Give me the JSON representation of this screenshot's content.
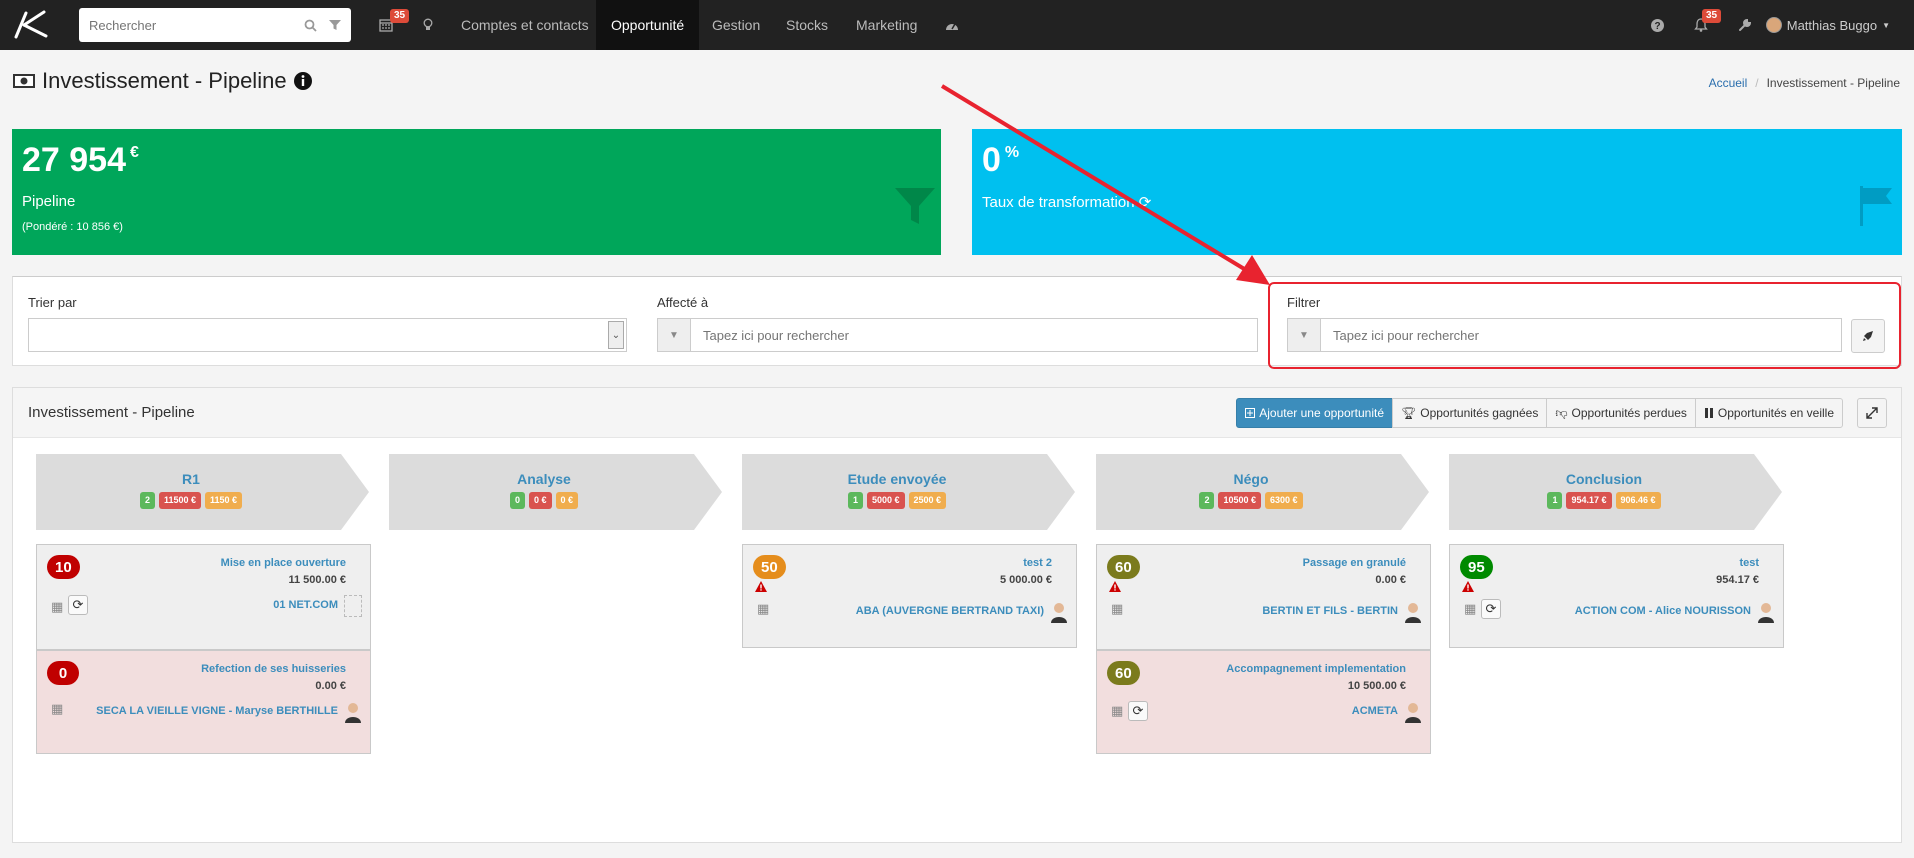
{
  "topbar": {
    "search_placeholder": "Rechercher",
    "calendar_badge": "35",
    "nav": [
      "Comptes et contacts",
      "Opportunité",
      "Gestion",
      "Stocks",
      "Marketing"
    ],
    "active_nav": "Opportunité",
    "bell_badge": "35",
    "user_name": "Matthias Buggo"
  },
  "header": {
    "title": "Investissement - Pipeline",
    "breadcrumb": [
      "Accueil",
      "Investissement - Pipeline"
    ]
  },
  "kpis": {
    "pipeline_value": "27 954",
    "pipeline_unit": "€",
    "pipeline_label": "Pipeline",
    "pipeline_sub": "(Pondéré : 10 856 €)",
    "rate_value": "0",
    "rate_unit": "%",
    "rate_label": "Taux de transformation"
  },
  "filters": {
    "sort_label": "Trier par",
    "assigned_label": "Affecté à",
    "assigned_placeholder": "Tapez ici pour rechercher",
    "filter_label": "Filtrer",
    "filter_placeholder": "Tapez ici pour rechercher"
  },
  "pipeline": {
    "title": "Investissement - Pipeline",
    "buttons": {
      "add": "Ajouter une opportunité",
      "won": "Opportunités gagnées",
      "lost": "Opportunités perdues",
      "standby": "Opportunités en veille"
    },
    "stages": [
      {
        "name": "R1",
        "count": "2",
        "total": "11500 €",
        "weighted": "1150 €"
      },
      {
        "name": "Analyse",
        "count": "0",
        "total": "0 €",
        "weighted": "0 €"
      },
      {
        "name": "Etude envoyée",
        "count": "1",
        "total": "5000 €",
        "weighted": "2500 €"
      },
      {
        "name": "Négo",
        "count": "2",
        "total": "10500 €",
        "weighted": "6300 €"
      },
      {
        "name": "Conclusion",
        "count": "1",
        "total": "954.17 €",
        "weighted": "906.46 €"
      }
    ],
    "cards": {
      "r1_a": {
        "score": "10",
        "title": "Mise en place ouverture",
        "amount": "11 500.00 €",
        "company": "01 NET.COM"
      },
      "r1_b": {
        "score": "0",
        "title": "Refection de ses huisseries",
        "amount": "0.00 €",
        "company": "SECA LA VIEILLE VIGNE - Maryse BERTHILLE"
      },
      "etude_a": {
        "score": "50",
        "title": "test 2",
        "amount": "5 000.00 €",
        "company": "ABA (AUVERGNE BERTRAND TAXI)"
      },
      "nego_a": {
        "score": "60",
        "title": "Passage en granulé",
        "amount": "0.00 €",
        "company": "BERTIN ET FILS - BERTIN"
      },
      "nego_b": {
        "score": "60",
        "title": "Accompagnement implementation",
        "amount": "10 500.00 €",
        "company": "ACMETA"
      },
      "concl_a": {
        "score": "95",
        "title": "test",
        "amount": "954.17 €",
        "company": "ACTION COM - Alice NOURISSON"
      }
    }
  },
  "colors": {
    "topbar": "#222222",
    "green_kpi": "#00a65a",
    "cyan_kpi": "#00c0ef",
    "primary": "#3c8dbc",
    "annotation": "#e8232f"
  }
}
